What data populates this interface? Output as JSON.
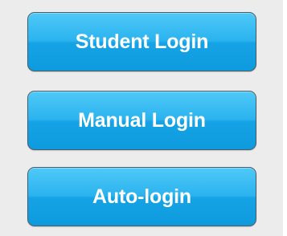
{
  "login_panel": {
    "buttons": [
      {
        "label": "Student Login"
      },
      {
        "label": "Manual Login"
      },
      {
        "label": "Auto-login"
      }
    ]
  },
  "colors": {
    "panel_background": "#ececec",
    "button_top": "#4fc9f7",
    "button_bottom": "#0e9bde",
    "button_border": "#4a5c66",
    "button_text": "#ffffff"
  }
}
